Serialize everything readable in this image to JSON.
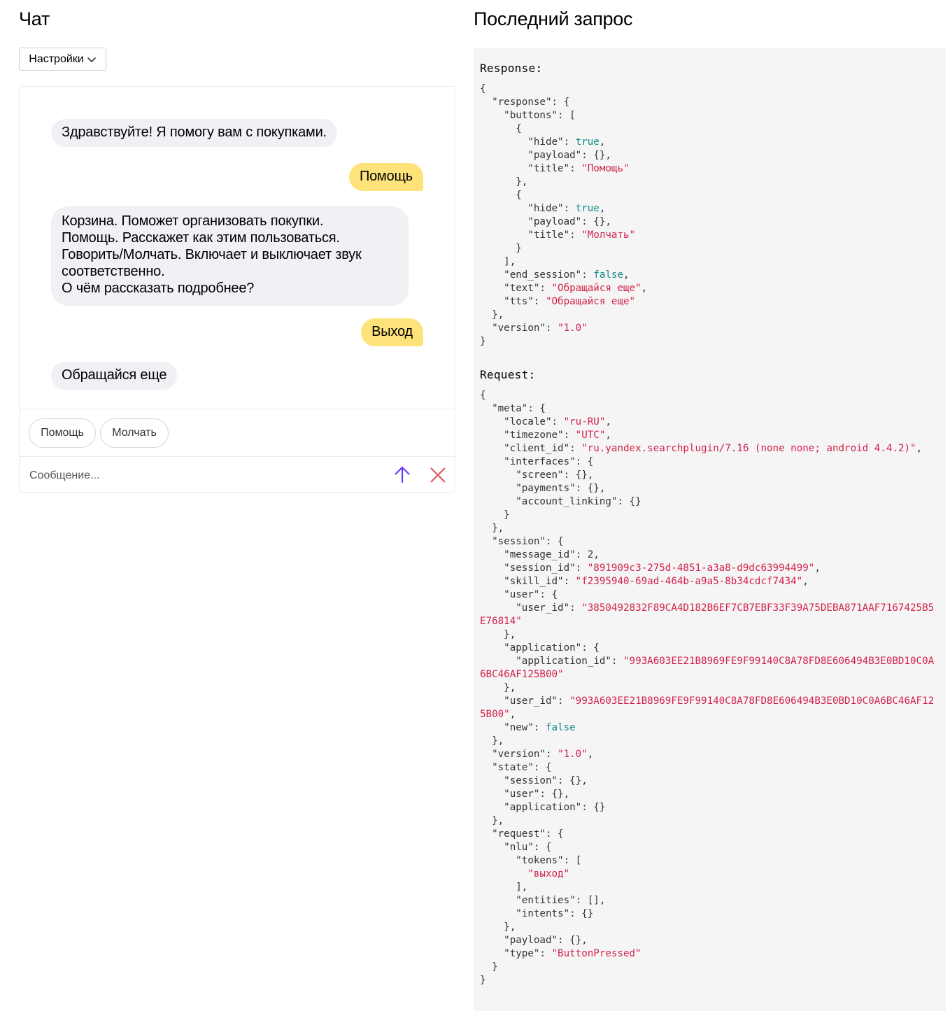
{
  "chat": {
    "title": "Чат",
    "settings_label": "Настройки",
    "messages": [
      {
        "from": "bot",
        "text": "Здравствуйте! Я помогу вам с покупками."
      },
      {
        "from": "user",
        "text": "Помощь"
      },
      {
        "from": "bot",
        "text": "Корзина. Поможет организовать покупки.\nПомощь. Расскажет как этим пользоваться.\nГоворить/Молчать. Включает и выключает звук соответственно.\nО чём рассказать подробнее?"
      },
      {
        "from": "user",
        "text": "Выход"
      },
      {
        "from": "bot",
        "text": "Обращайся еще"
      }
    ],
    "quick_buttons": [
      "Помощь",
      "Молчать"
    ],
    "input": {
      "placeholder": "Сообщение...",
      "value": ""
    }
  },
  "last_request": {
    "title": "Последний запрос",
    "response_label": "Response:",
    "response_json": "{\n  \"response\": {\n    \"buttons\": [\n      {\n        \"hide\": true,\n        \"payload\": {},\n        \"title\": \"Помощь\"\n      },\n      {\n        \"hide\": true,\n        \"payload\": {},\n        \"title\": \"Молчать\"\n      }\n    ],\n    \"end_session\": false,\n    \"text\": \"Обращайся еще\",\n    \"tts\": \"Обращайся еще\"\n  },\n  \"version\": \"1.0\"\n}",
    "request_label": "Request:",
    "request_json": "{\n  \"meta\": {\n    \"locale\": \"ru-RU\",\n    \"timezone\": \"UTC\",\n    \"client_id\": \"ru.yandex.searchplugin/7.16 (none none; android 4.4.2)\",\n    \"interfaces\": {\n      \"screen\": {},\n      \"payments\": {},\n      \"account_linking\": {}\n    }\n  },\n  \"session\": {\n    \"message_id\": 2,\n    \"session_id\": \"891909c3-275d-4851-a3a8-d9dc63994499\",\n    \"skill_id\": \"f2395940-69ad-464b-a9a5-8b34cdcf7434\",\n    \"user\": {\n      \"user_id\": \"3850492832F89CA4D182B6EF7CB7EBF33F39A75DEBA871AAF7167425B5E76814\"\n    },\n    \"application\": {\n      \"application_id\": \"993A603EE21B8969FE9F99140C8A78FD8E606494B3E0BD10C0A6BC46AF125B00\"\n    },\n    \"user_id\": \"993A603EE21B8969FE9F99140C8A78FD8E606494B3E0BD10C0A6BC46AF125B00\",\n    \"new\": false\n  },\n  \"version\": \"1.0\",\n  \"state\": {\n    \"session\": {},\n    \"user\": {},\n    \"application\": {}\n  },\n  \"request\": {\n    \"nlu\": {\n      \"tokens\": [\n        \"выход\"\n      ],\n      \"entities\": [],\n      \"intents\": {}\n    },\n    \"payload\": {},\n    \"type\": \"ButtonPressed\"\n  }\n}"
  },
  "colors": {
    "bot_bubble": "#f0f1f5",
    "user_bubble": "#fde37a",
    "send_icon": "#6b3cf5",
    "clear_icon": "#e0565b",
    "json_string": "#d3234c",
    "json_bool": "#0f8a84",
    "code_bg": "#f5f5f5"
  }
}
